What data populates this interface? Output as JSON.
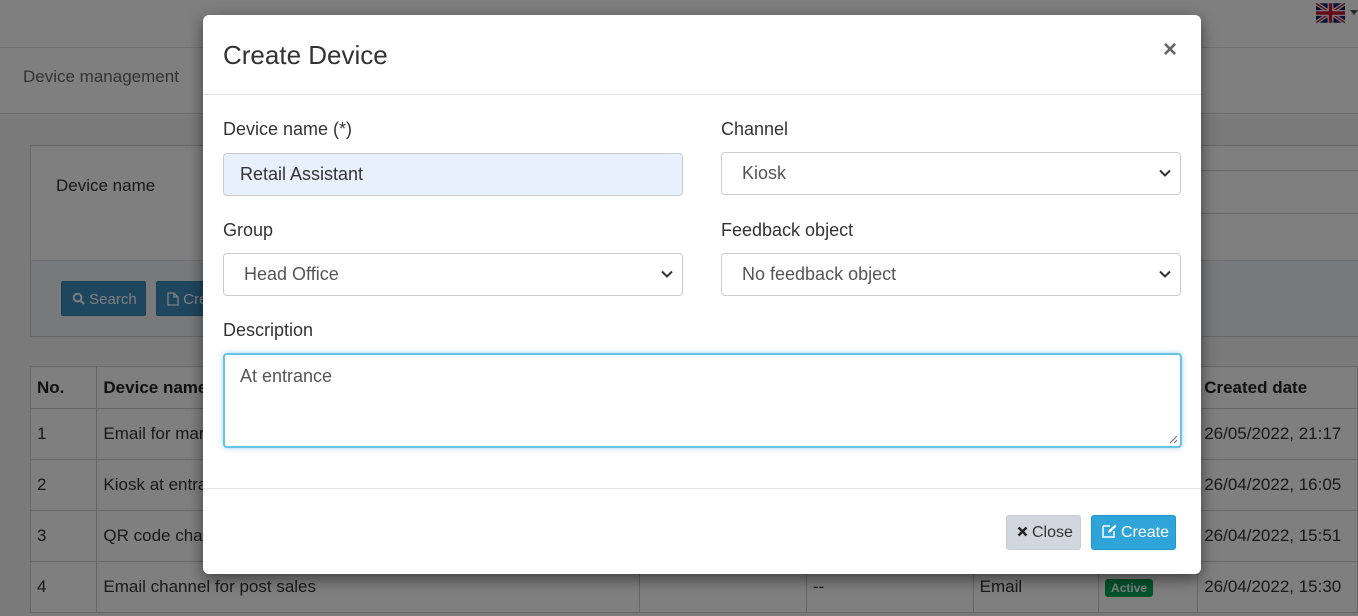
{
  "background": {
    "breadcrumb": "Device management",
    "filter": {
      "device_name_label": "Device name",
      "search_button": "Search",
      "create_button": "Cre"
    },
    "table": {
      "headers": [
        "No.",
        "Device name",
        "",
        "",
        "",
        "",
        "Created date"
      ],
      "rows": [
        {
          "no": "1",
          "name": "Email for mar",
          "c3": "",
          "c4": "",
          "channel": "",
          "status": "",
          "date": "26/05/2022, 21:17"
        },
        {
          "no": "2",
          "name": "Kiosk at entra",
          "c3": "",
          "c4": "",
          "channel": "",
          "status": "",
          "date": "26/04/2022, 16:05"
        },
        {
          "no": "3",
          "name": "QR code cha",
          "c3": "",
          "c4": "",
          "channel": "",
          "status": "",
          "date": "26/04/2022, 15:51"
        },
        {
          "no": "4",
          "name": "Email channel for post sales",
          "c3": "",
          "c4": "--",
          "channel": "Email",
          "status": "Active",
          "date": "26/04/2022, 15:30"
        }
      ]
    }
  },
  "modal": {
    "title": "Create Device",
    "close_symbol": "×",
    "fields": {
      "device_name": {
        "label": "Device name (*)",
        "value": "Retail Assistant"
      },
      "channel": {
        "label": "Channel",
        "value": "Kiosk"
      },
      "group": {
        "label": "Group",
        "value": "Head Office"
      },
      "feedback_object": {
        "label": "Feedback object",
        "value": "No feedback object"
      },
      "description": {
        "label": "Description",
        "value": "At entrance"
      }
    },
    "buttons": {
      "close": "Close",
      "create": "Create"
    }
  },
  "colors": {
    "primary_button": "#2fa4d9",
    "secondary_button": "#d2d6de",
    "active_badge": "#00a65a",
    "focus_border": "#66c3e6",
    "input_autofill_bg": "#e8f0fe"
  }
}
